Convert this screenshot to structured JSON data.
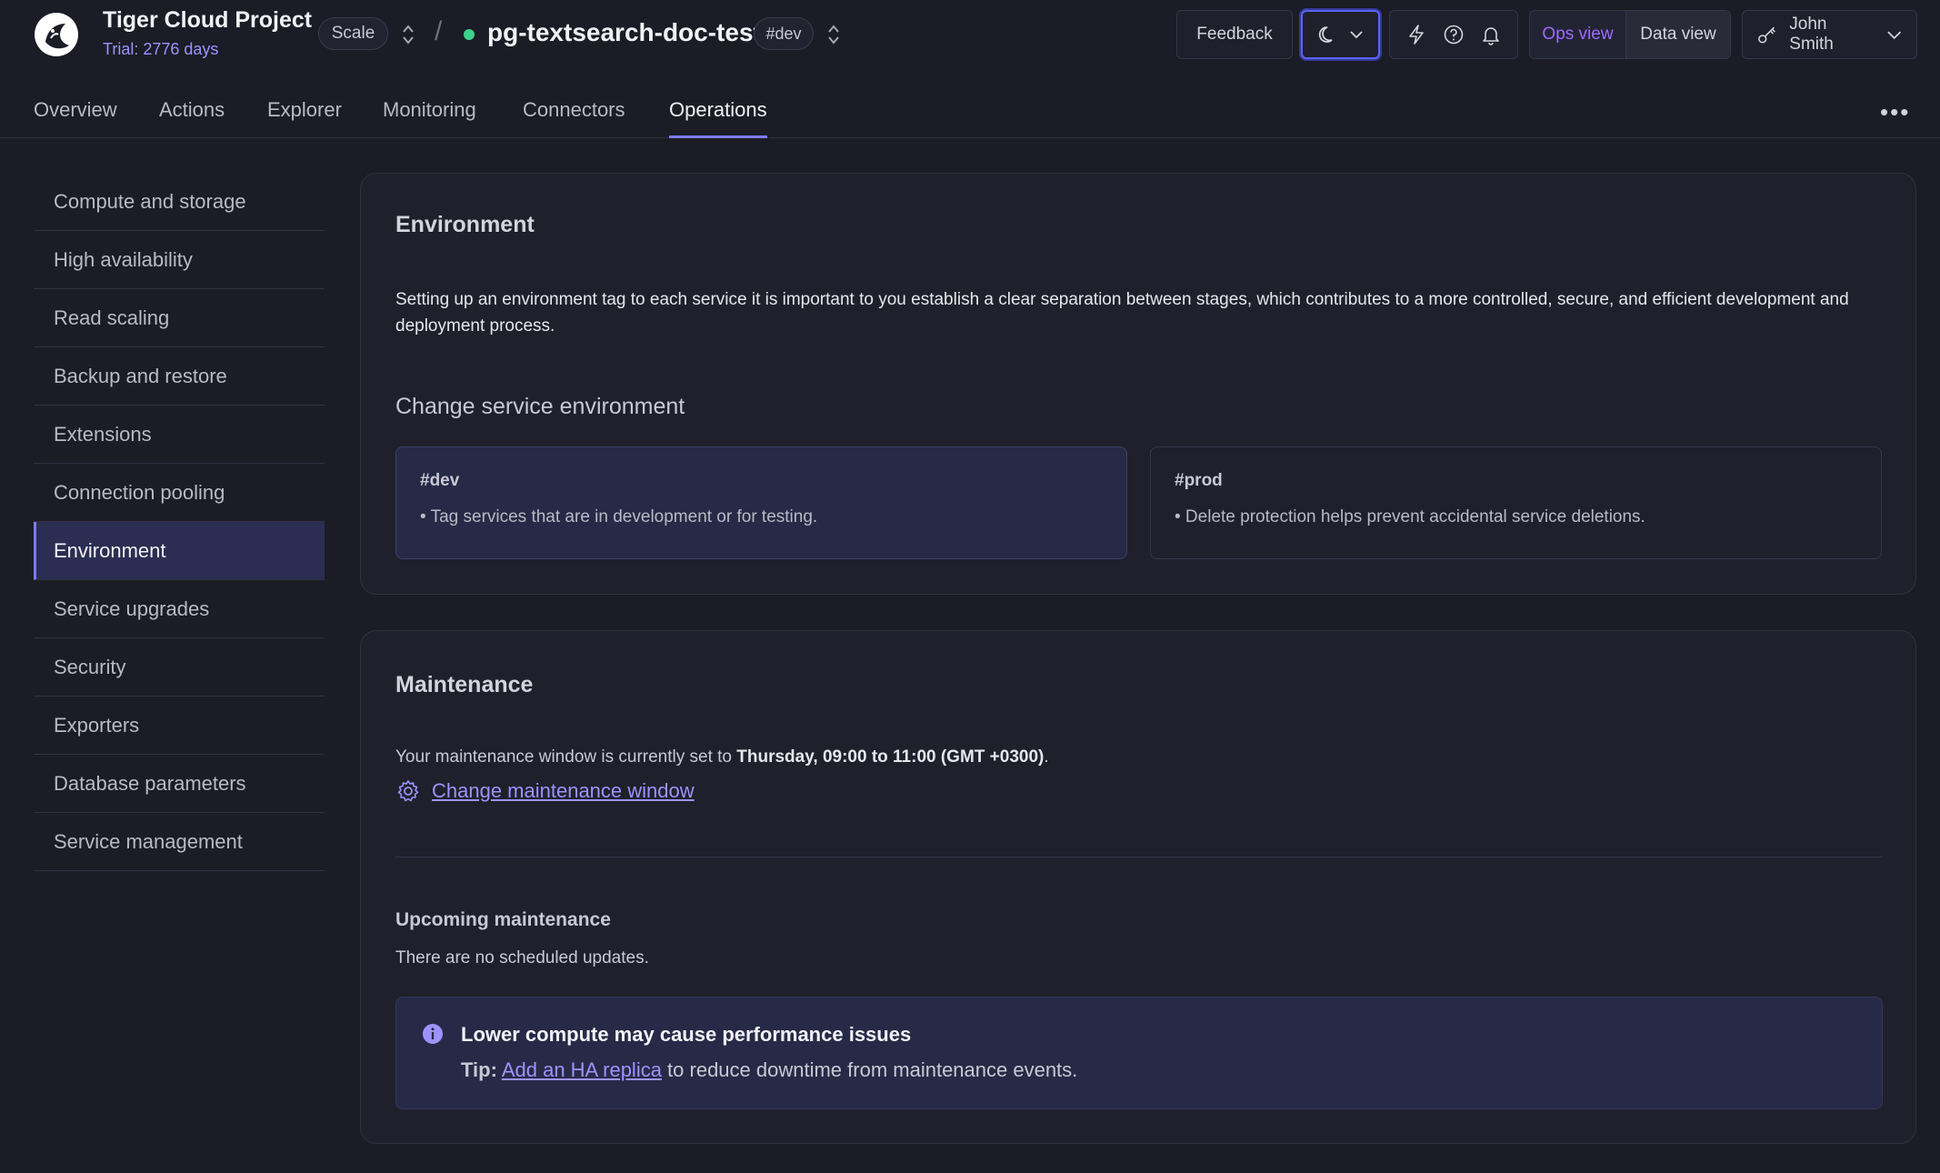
{
  "header": {
    "project_name": "Tiger Cloud Project",
    "trial": "Trial: 2776 days",
    "plan_pill": "Scale",
    "separator": "/",
    "service_name": "pg-textsearch-doc-test",
    "service_tag": "#dev",
    "feedback_label": "Feedback",
    "ops_view_label": "Ops view",
    "data_view_label": "Data view",
    "user_name": "John Smith",
    "status_color": "#3fcf8e",
    "accent_color": "#7d7bff"
  },
  "tabs": [
    {
      "label": "Overview"
    },
    {
      "label": "Actions"
    },
    {
      "label": "Explorer"
    },
    {
      "label": "Monitoring"
    },
    {
      "label": "Connectors"
    },
    {
      "label": "Operations"
    }
  ],
  "more_label": "•••",
  "sidebar": {
    "items": [
      {
        "label": "Compute and storage"
      },
      {
        "label": "High availability"
      },
      {
        "label": "Read scaling"
      },
      {
        "label": "Backup and restore"
      },
      {
        "label": "Extensions"
      },
      {
        "label": "Connection pooling"
      },
      {
        "label": "Environment"
      },
      {
        "label": "Service upgrades"
      },
      {
        "label": "Security"
      },
      {
        "label": "Exporters"
      },
      {
        "label": "Database parameters"
      },
      {
        "label": "Service management"
      }
    ],
    "active": "Environment"
  },
  "environment": {
    "title": "Environment",
    "description": "Setting up an environment tag to each service it is important to you establish a clear separation between stages, which contributes to a more controlled, secure, and efficient development and deployment process.",
    "change_title": "Change service environment",
    "options": [
      {
        "title": "#dev",
        "desc": "• Tag services that are in development or for testing."
      },
      {
        "title": "#prod",
        "desc": "• Delete protection helps prevent accidental service deletions."
      }
    ],
    "selected": "#dev"
  },
  "maintenance": {
    "title": "Maintenance",
    "text_prefix": "Your maintenance window is currently set to ",
    "window": "Thursday, 09:00 to 11:00 (GMT +0300)",
    "text_suffix": ".",
    "change_link": "Change maintenance window",
    "upcoming_title": "Upcoming maintenance",
    "upcoming_text": "There are no scheduled updates.",
    "alert_title": "Lower compute may cause performance issues",
    "alert_tip_label": "Tip:",
    "alert_tip_link": "Add an HA replica",
    "alert_tip_suffix": " to reduce downtime from maintenance events."
  },
  "icons": {
    "logo": "tiger-logo-icon",
    "theme": "moon-icon",
    "quick": "lightning-icon",
    "help": "help-circle-icon",
    "notifications": "bell-icon",
    "user": "key-icon",
    "settings": "gear-icon",
    "info": "info-icon"
  }
}
